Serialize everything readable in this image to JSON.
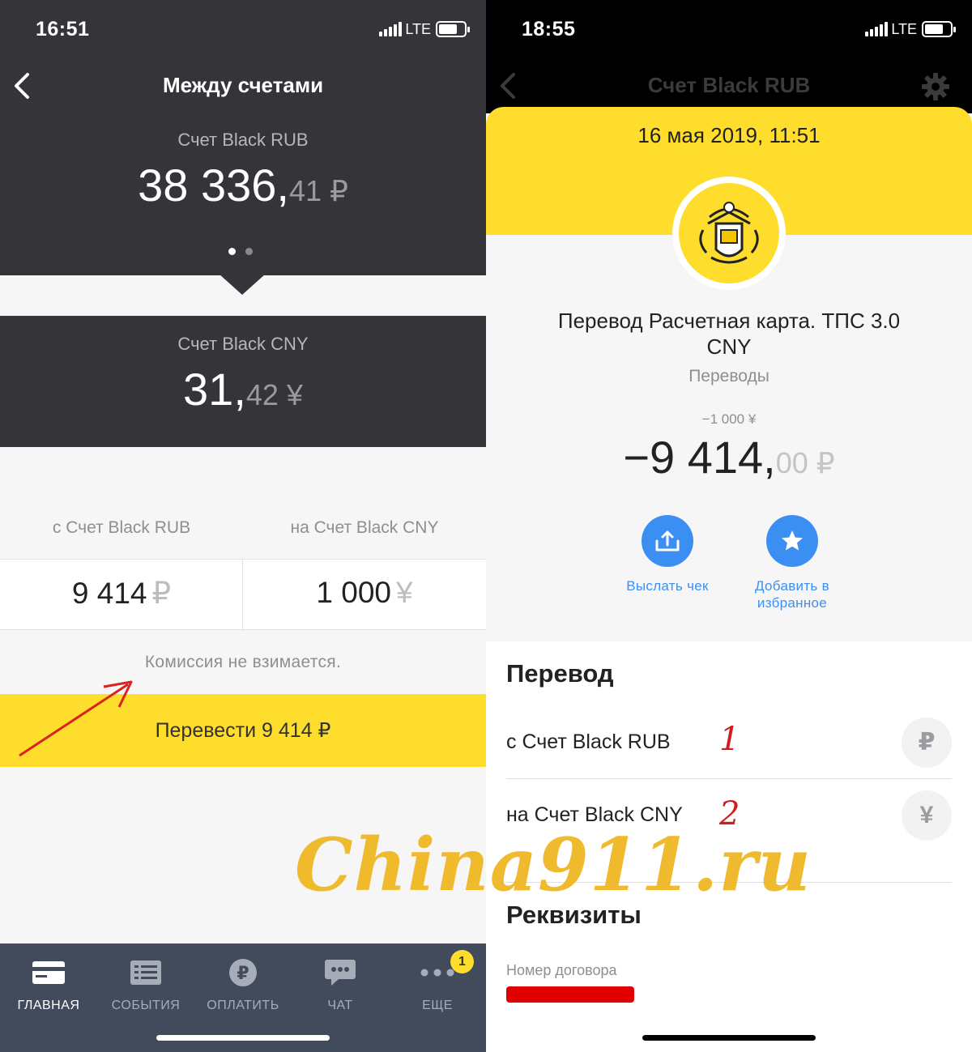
{
  "left_screen": {
    "status": {
      "time": "16:51",
      "network": "LTE"
    },
    "title": "Между счетами",
    "source_account": {
      "name": "Счет Black RUB",
      "balance_int": "38 336,",
      "balance_frac": "41 ₽"
    },
    "carousel": {
      "pages": 2,
      "active": 0
    },
    "target_account": {
      "name": "Счет Black CNY",
      "balance_int": "31,",
      "balance_frac": "42 ¥"
    },
    "from_label": "с Счет Black RUB",
    "to_label": "на Счет Black CNY",
    "from_amount": "9 414",
    "from_currency": "₽",
    "to_amount": "1 000",
    "to_currency": "¥",
    "fee_note": "Комиссия не взимается.",
    "transfer_button": "Перевести 9 414 ₽",
    "tabs": [
      {
        "label": "ГЛАВНАЯ",
        "icon": "card-icon"
      },
      {
        "label": "СОБЫТИЯ",
        "icon": "list-icon"
      },
      {
        "label": "ОПЛАТИТЬ",
        "icon": "ruble-icon"
      },
      {
        "label": "ЧАТ",
        "icon": "chat-icon"
      },
      {
        "label": "ЕЩЕ",
        "icon": "more-icon"
      }
    ],
    "more_badge": "1"
  },
  "right_screen": {
    "status": {
      "time": "18:55",
      "network": "LTE"
    },
    "title": "Счет Black RUB",
    "date": "16 мая 2019, 11:51",
    "operation_name": "Перевод Расчетная карта. ТПС 3.0 CNY",
    "category": "Переводы",
    "original_amount": "−1 000 ¥",
    "amount_int": "−9 414,",
    "amount_frac": "00 ₽",
    "actions": [
      {
        "label": "Выслать чек",
        "icon": "share-icon"
      },
      {
        "label": "Добавить в избранное",
        "icon": "star-icon"
      }
    ],
    "transfer_section": {
      "title": "Перевод",
      "rows": [
        {
          "text": "с Счет Black RUB",
          "mark": "1",
          "currency_icon": "₽"
        },
        {
          "text": "на Счет Black CNY",
          "mark": "2",
          "currency_icon": "¥"
        }
      ]
    },
    "details_section": {
      "title": "Реквизиты",
      "contract_label": "Номер договора"
    }
  },
  "watermark": "China911.ru",
  "colors": {
    "dark_header": "#353539",
    "brand_yellow": "#ffdd2d",
    "action_blue": "#3c8ff2",
    "tabbar": "#414b5c",
    "annotation_red": "#d11d1d"
  }
}
